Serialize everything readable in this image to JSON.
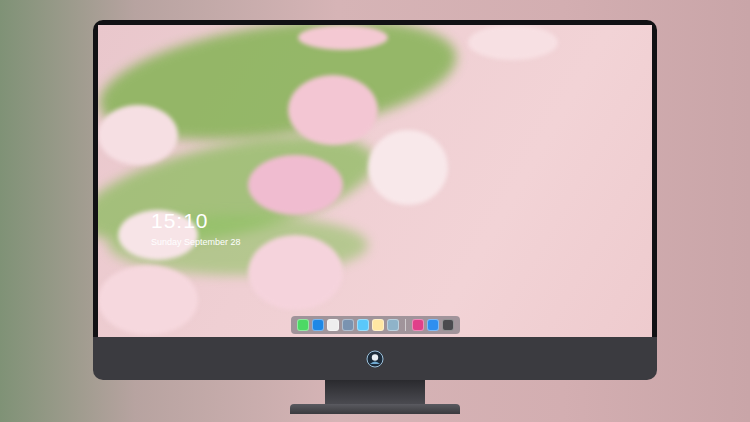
{
  "lock_screen": {
    "time": "15:10",
    "date": "Sunday September 28"
  },
  "dock": {
    "apps": [
      {
        "color": "#4cd964"
      },
      {
        "color": "#1e88e5"
      },
      {
        "color": "#eeeeee"
      },
      {
        "color": "#7a93b0"
      },
      {
        "color": "#5ac8fa"
      },
      {
        "color": "#ffe7a3"
      },
      {
        "color": "#8fb3c9"
      }
    ],
    "extras": [
      {
        "color": "#e0408a"
      },
      {
        "color": "#2f8ff0"
      },
      {
        "color": "#4a4a4e"
      }
    ]
  }
}
